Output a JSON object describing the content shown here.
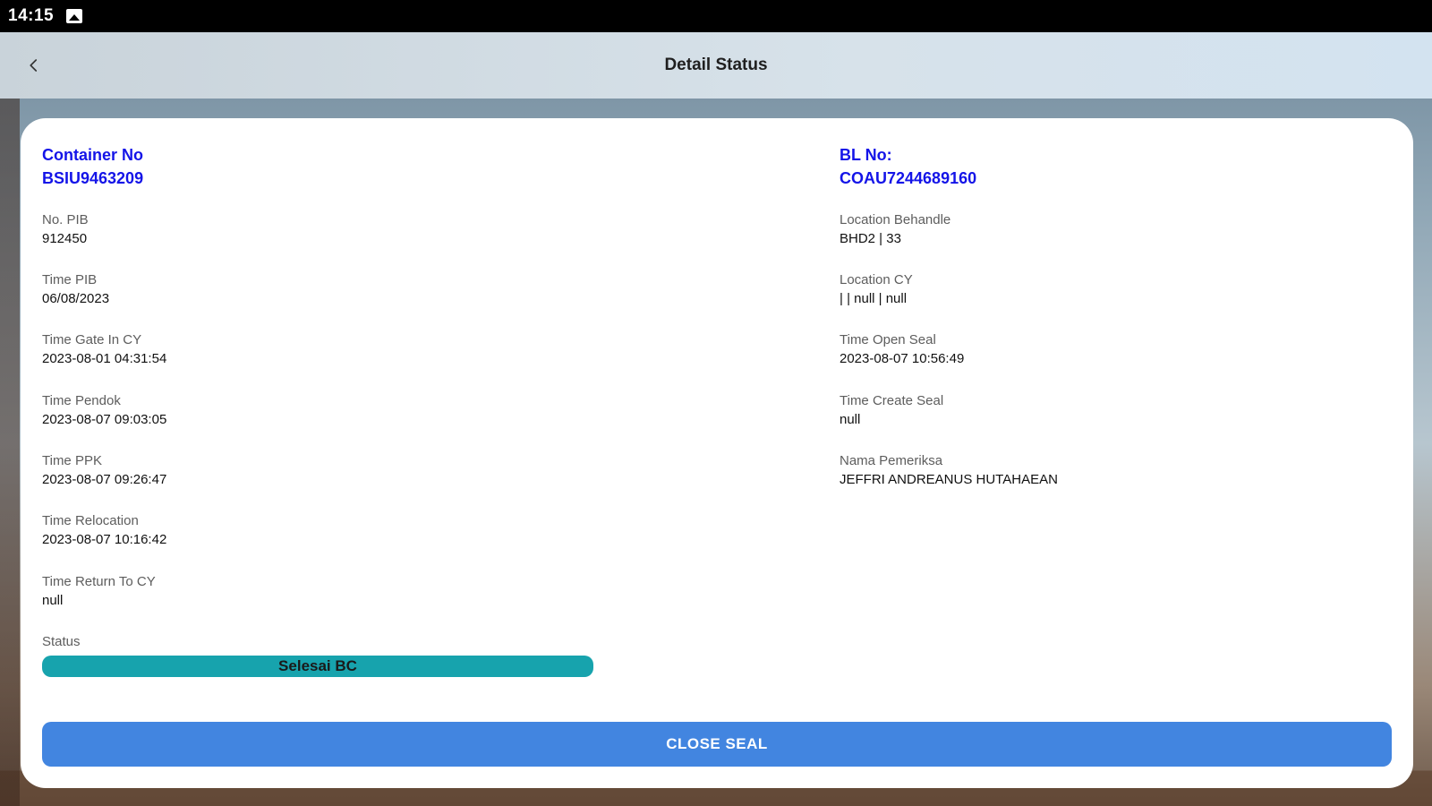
{
  "statusbar": {
    "time": "14:15",
    "icon": "image-icon"
  },
  "appbar": {
    "title": "Detail Status",
    "back_icon": "chevron-left-icon"
  },
  "container": {
    "label": "Container No",
    "value": "BSIU9463209"
  },
  "bl": {
    "label": "BL No:",
    "value": "COAU7244689160"
  },
  "left_fields": [
    {
      "label": "No. PIB",
      "value": "912450"
    },
    {
      "label": "Time PIB",
      "value": "06/08/2023"
    },
    {
      "label": "Time Gate In CY",
      "value": "2023-08-01 04:31:54"
    },
    {
      "label": "Time Pendok",
      "value": "2023-08-07 09:03:05"
    },
    {
      "label": "Time PPK",
      "value": "2023-08-07 09:26:47"
    },
    {
      "label": "Time Relocation",
      "value": "2023-08-07 10:16:42"
    },
    {
      "label": "Time Return To CY",
      "value": "null"
    }
  ],
  "right_fields": [
    {
      "label": "Location Behandle",
      "value": "BHD2 | 33"
    },
    {
      "label": "Location CY",
      "value": "| | null | null"
    },
    {
      "label": "Time Open Seal",
      "value": "2023-08-07 10:56:49"
    },
    {
      "label": "Time Create Seal",
      "value": "null"
    },
    {
      "label": "Nama Pemeriksa",
      "value": "JEFFRI ANDREANUS HUTAHAEAN"
    }
  ],
  "status": {
    "label": "Status",
    "value": "Selesai BC",
    "color": "#17a3ad"
  },
  "action": {
    "close_seal_label": "CLOSE SEAL",
    "color": "#4285e0"
  }
}
